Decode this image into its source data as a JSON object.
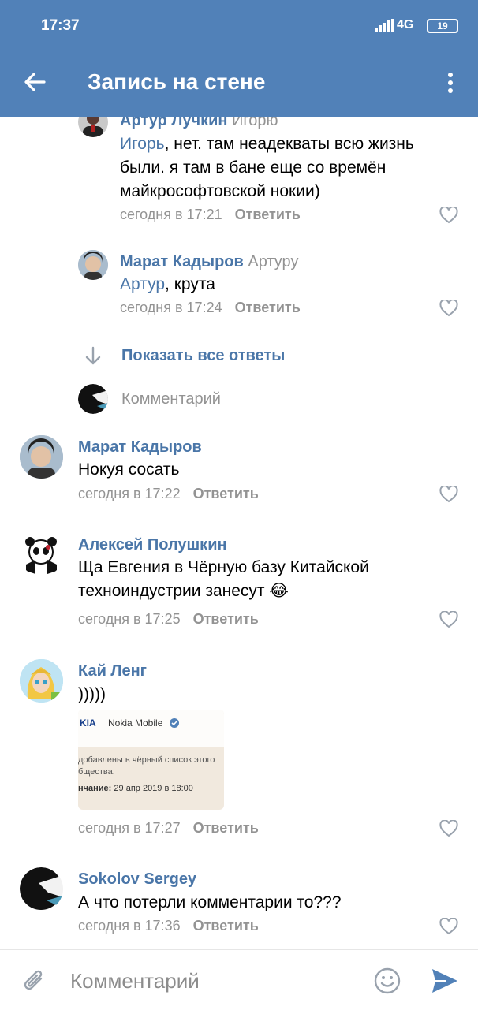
{
  "status_bar": {
    "time": "17:37",
    "network": "4G",
    "battery": "19"
  },
  "header": {
    "title": "Запись на стене"
  },
  "comments": [
    {
      "author": "Артур Лучкин",
      "reply_to": "Игорю",
      "mention": "Игорь",
      "text": ", нет. там неадекваты всю жизнь были. я там в бане еще со времён майкрософтовской нокии)",
      "time": "сегодня в 17:21",
      "reply": "Ответить"
    },
    {
      "author": "Марат Кадыров",
      "reply_to": "Артуру",
      "mention": "Артур",
      "text": ", крута",
      "time": "сегодня в 17:24",
      "reply": "Ответить"
    },
    {
      "author": "Марат Кадыров",
      "text": "Нокуя сосать",
      "time": "сегодня в 17:22",
      "reply": "Ответить"
    },
    {
      "author": "Алексей Полушкин",
      "text": "Ща Евгения в Чёрную базу Китайской техноиндустрии занесут 😂",
      "time": "сегодня в 17:25",
      "reply": "Ответить"
    },
    {
      "author": "Кай Ленг",
      "text": ")))))",
      "time": "сегодня в 17:27",
      "reply": "Ответить"
    },
    {
      "author": "Sokolov Sergey",
      "text": "А что потерли комментарии то???",
      "time": "сегодня в 17:36",
      "reply": "Ответить"
    }
  ],
  "thread": {
    "show_all": "Показать все ответы",
    "comment_placeholder": "Комментарий"
  },
  "attachment": {
    "brand": "KIA",
    "account": "Nokia Mobile",
    "line1": "добавлены в чёрный список этого",
    "line2": "бщества.",
    "until_label": "нчание:",
    "until_value": "29 апр 2019 в 18:00"
  },
  "composer": {
    "placeholder": "Комментарий"
  },
  "colors": {
    "header": "#5181b8",
    "link": "#4a76a8",
    "meta": "#939393",
    "send": "#5181b8"
  }
}
